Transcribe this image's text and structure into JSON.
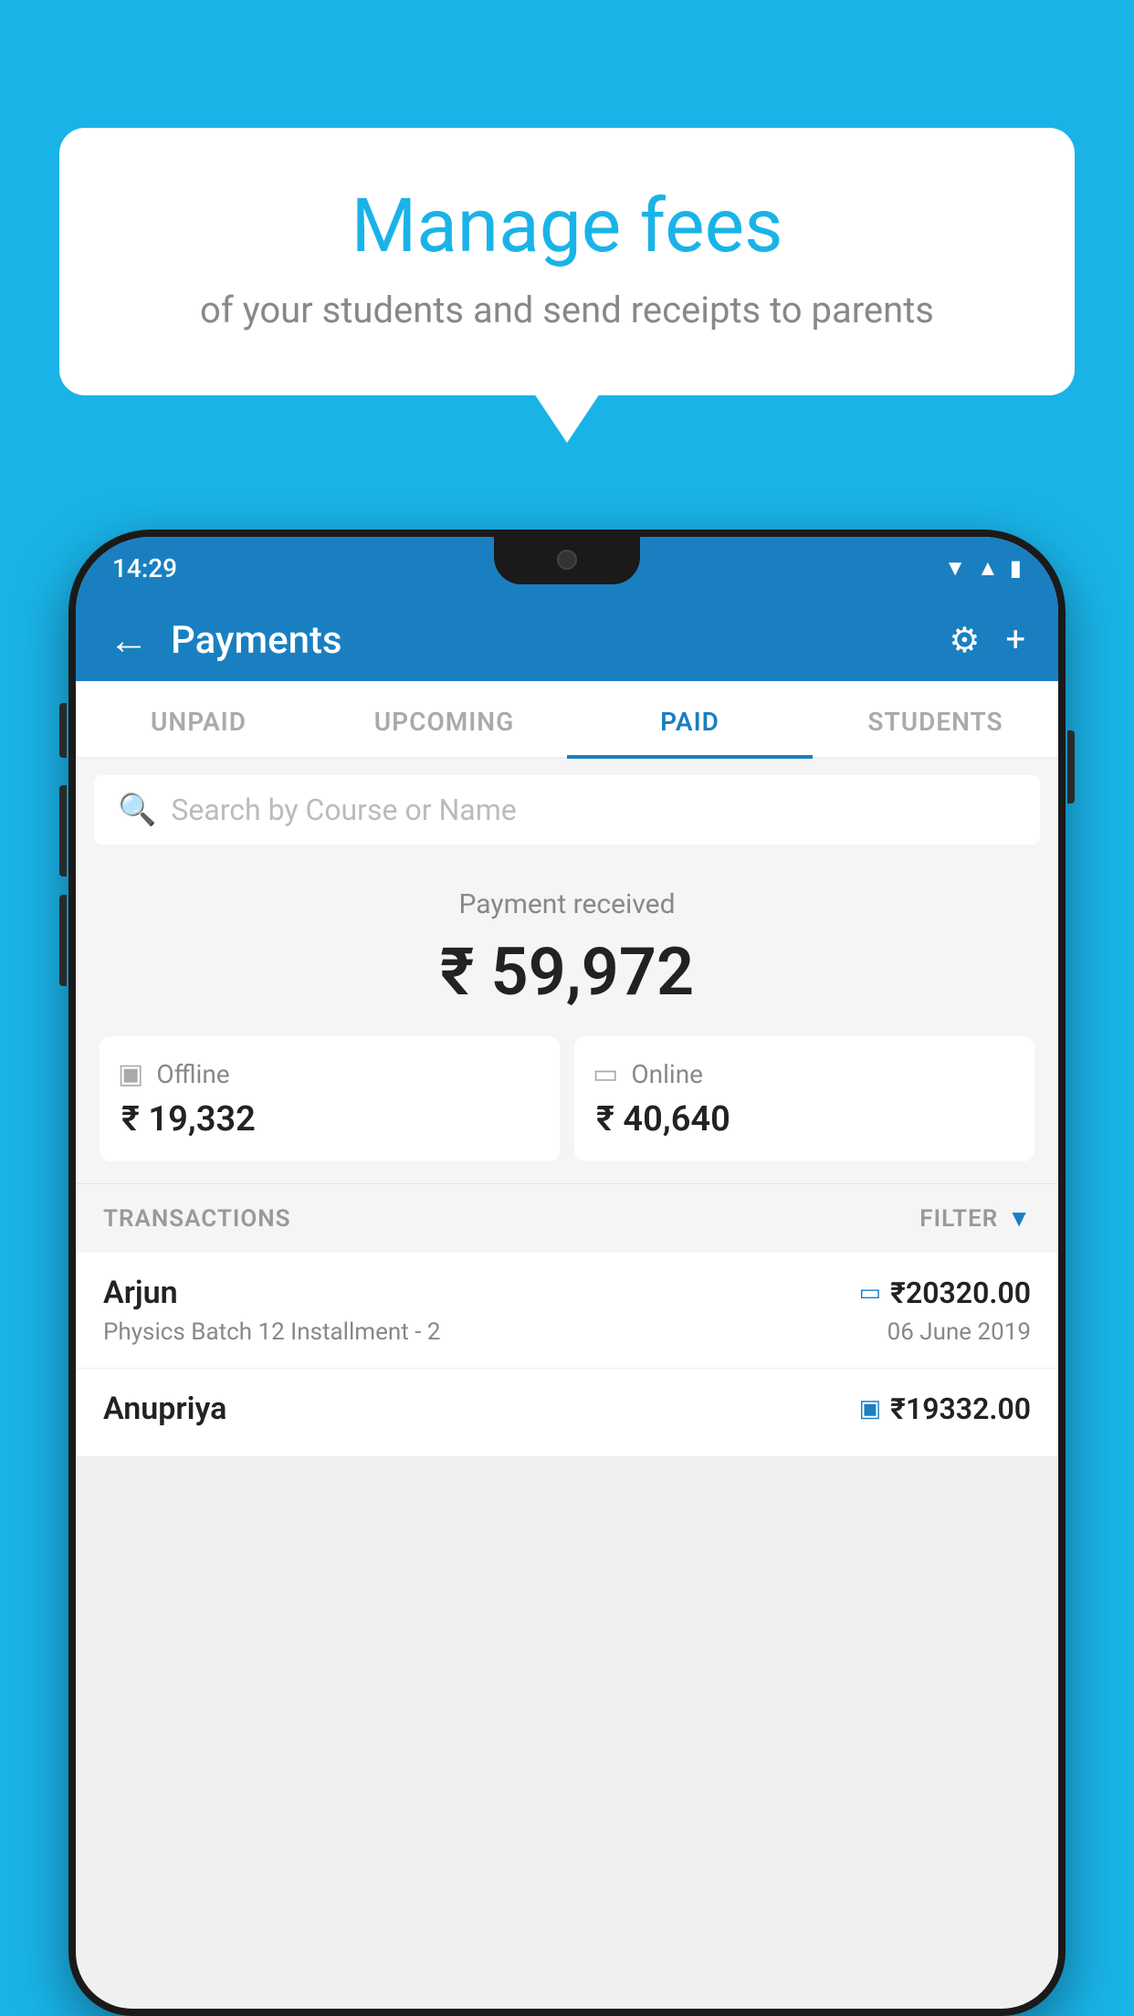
{
  "page": {
    "bg_color": "#1ab3e8"
  },
  "speech_bubble": {
    "title": "Manage fees",
    "subtitle": "of your students and send receipts to parents"
  },
  "status_bar": {
    "time": "14:29",
    "wifi_icon": "▼",
    "signal_icon": "▲",
    "battery_icon": "▮"
  },
  "app_bar": {
    "back_icon": "←",
    "title": "Payments",
    "settings_icon": "⚙",
    "add_icon": "+"
  },
  "tabs": [
    {
      "id": "unpaid",
      "label": "UNPAID",
      "active": false
    },
    {
      "id": "upcoming",
      "label": "UPCOMING",
      "active": false
    },
    {
      "id": "paid",
      "label": "PAID",
      "active": true
    },
    {
      "id": "students",
      "label": "STUDENTS",
      "active": false
    }
  ],
  "search": {
    "placeholder": "Search by Course or Name"
  },
  "payment_summary": {
    "label": "Payment received",
    "amount": "₹ 59,972",
    "offline_label": "Offline",
    "offline_amount": "₹ 19,332",
    "online_label": "Online",
    "online_amount": "₹ 40,640"
  },
  "transactions_header": {
    "label": "TRANSACTIONS",
    "filter_label": "FILTER"
  },
  "transactions": [
    {
      "name": "Arjun",
      "detail": "Physics Batch 12 Installment - 2",
      "amount": "₹20320.00",
      "date": "06 June 2019",
      "type": "online"
    },
    {
      "name": "Anupriya",
      "detail": "",
      "amount": "₹19332.00",
      "date": "",
      "type": "offline"
    }
  ]
}
